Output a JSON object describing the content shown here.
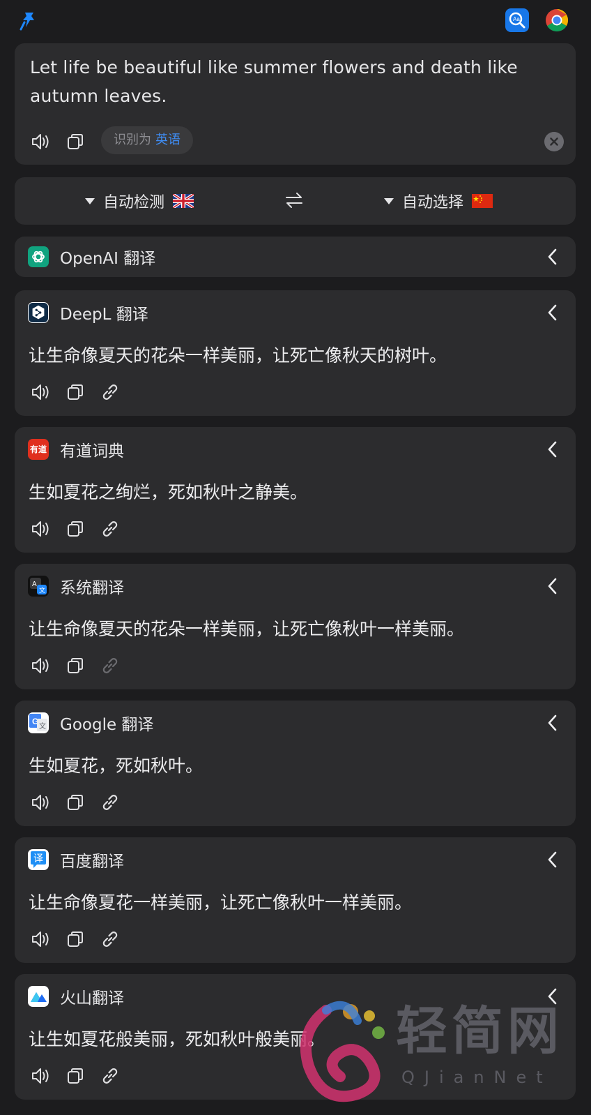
{
  "window": {
    "pin_icon": "pin-icon",
    "apps": [
      "eudic-app-icon",
      "chrome-app-icon"
    ]
  },
  "input": {
    "text": "Let life be beautiful like summer flowers and death like autumn leaves.",
    "detected_prefix": "识别为",
    "detected_lang": "英语"
  },
  "languages": {
    "from": "自动检测",
    "from_flag": "uk-flag",
    "to": "自动选择",
    "to_flag": "china-flag"
  },
  "services": [
    {
      "name": "OpenAI 翻译",
      "logo": "openai-logo",
      "collapsed": true
    },
    {
      "name": "DeepL 翻译",
      "logo": "deepl-logo",
      "result": "让生命像夏天的花朵一样美丽，让死亡像秋天的树叶。"
    },
    {
      "name": "有道词典",
      "logo": "youdao-logo",
      "logo_text": "有道",
      "result": "生如夏花之绚烂，死如秋叶之静美。"
    },
    {
      "name": "系统翻译",
      "logo": "apple-translate-logo",
      "result": "让生命像夏天的花朵一样美丽，让死亡像秋叶一样美丽。"
    },
    {
      "name": "Google 翻译",
      "logo": "google-translate-logo",
      "result": "生如夏花，死如秋叶。"
    },
    {
      "name": "百度翻译",
      "logo": "baidu-translate-logo",
      "logo_text": "译",
      "result": "让生命像夏花一样美丽，让死亡像秋叶一样美丽。"
    },
    {
      "name": "火山翻译",
      "logo": "volcano-translate-logo",
      "result": "让生如夏花般美丽，死如秋叶般美丽。"
    }
  ],
  "colors": {
    "background": "#1c1c1e",
    "card": "#2c2c2e",
    "accent": "#3f8cf2"
  },
  "watermark": {
    "text": "轻简网",
    "sub": "QJianNet"
  }
}
